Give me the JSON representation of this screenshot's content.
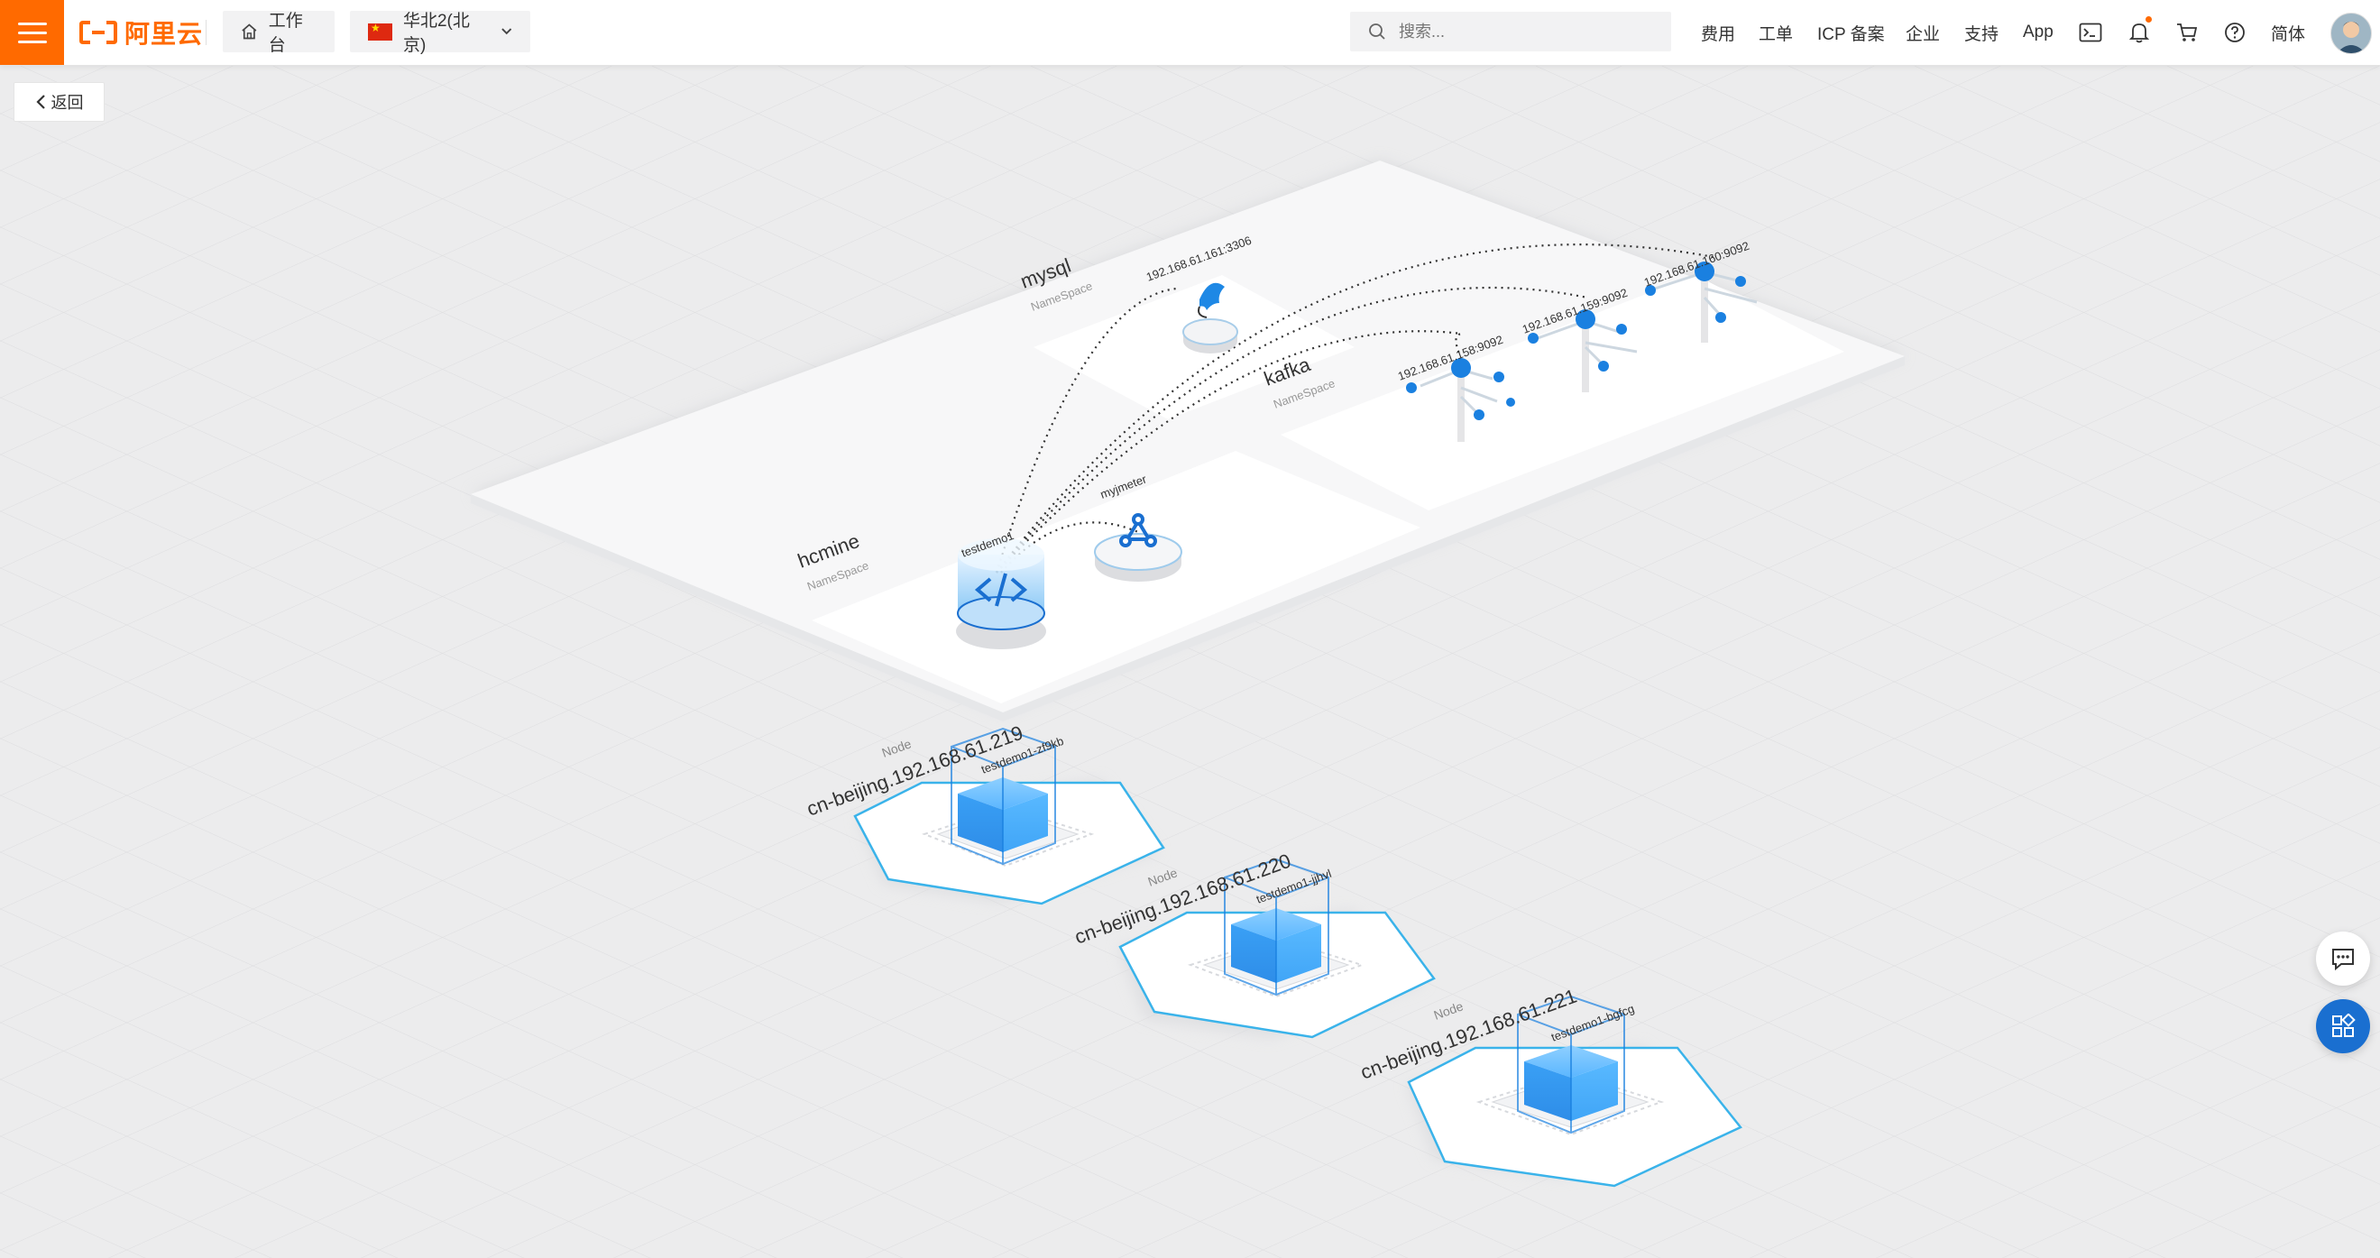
{
  "header": {
    "logo_text": "阿里云",
    "workbench_label": "工作台",
    "region_label": "华北2(北京)",
    "search_placeholder": "搜索...",
    "nav": [
      "费用",
      "工单",
      "ICP 备案",
      "企业",
      "支持",
      "App"
    ],
    "language_label": "简体"
  },
  "back_label": "返回",
  "namespaces": {
    "mysql": {
      "name": "mysql",
      "kind": "NameSpace",
      "endpoint": "192.168.61.161:3306"
    },
    "kafka": {
      "name": "kafka",
      "kind": "NameSpace",
      "brokers": [
        "192.168.61.158:9092",
        "192.168.61.159:9092",
        "192.168.61.160:9092"
      ]
    },
    "hcmine": {
      "name": "hcmine",
      "kind": "NameSpace",
      "apps": [
        "testdemo1",
        "myjmeter"
      ]
    }
  },
  "nodes": [
    {
      "kind": "Node",
      "name": "cn-beijing.192.168.61.219",
      "pod": "testdemo1-zf9kb"
    },
    {
      "kind": "Node",
      "name": "cn-beijing.192.168.61.220",
      "pod": "testdemo1-jjhvl"
    },
    {
      "kind": "Node",
      "name": "cn-beijing.192.168.61.221",
      "pod": "testdemo1-bgfcg"
    }
  ],
  "colors": {
    "brand": "#ff6a00",
    "accent_blue": "#1a6fd0",
    "node_blue": "#3aa0f5"
  }
}
